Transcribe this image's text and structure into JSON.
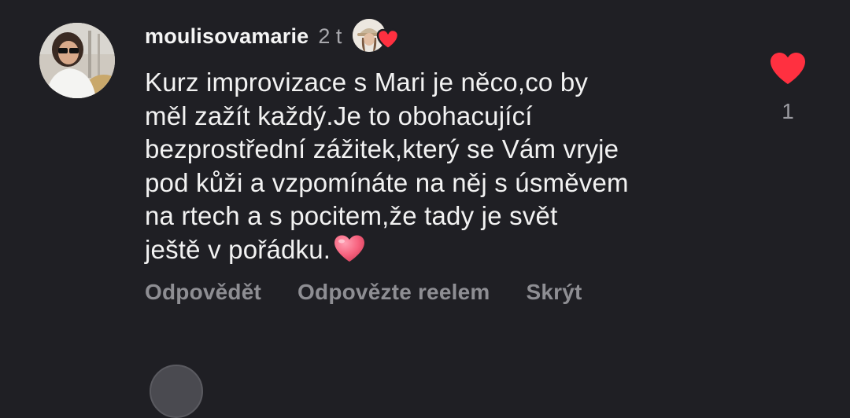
{
  "comment": {
    "username": "moulisovamarie",
    "time": "2 t",
    "text": "Kurz improvizace s Mari je něco,co by\nměl zažít každý.Je to obohacující\nbezprostřední zážitek,který se Vám vryje\npod kůži a vzpomínáte na něj s úsměvem\nna rtech a s pocitem,že tady je svět\nještě v pořádku.",
    "text_emoji": "pink-heart",
    "likes": "1",
    "liked": true,
    "creator_liked": true
  },
  "actions": {
    "reply": "Odpovědět",
    "reply_reel": "Odpovězte reelem",
    "hide": "Skrýt"
  },
  "colors": {
    "background": "#1f1f24",
    "like_red": "#ff3040",
    "emoji_pink": "#f7627e",
    "muted_text": "#8e8e93"
  }
}
